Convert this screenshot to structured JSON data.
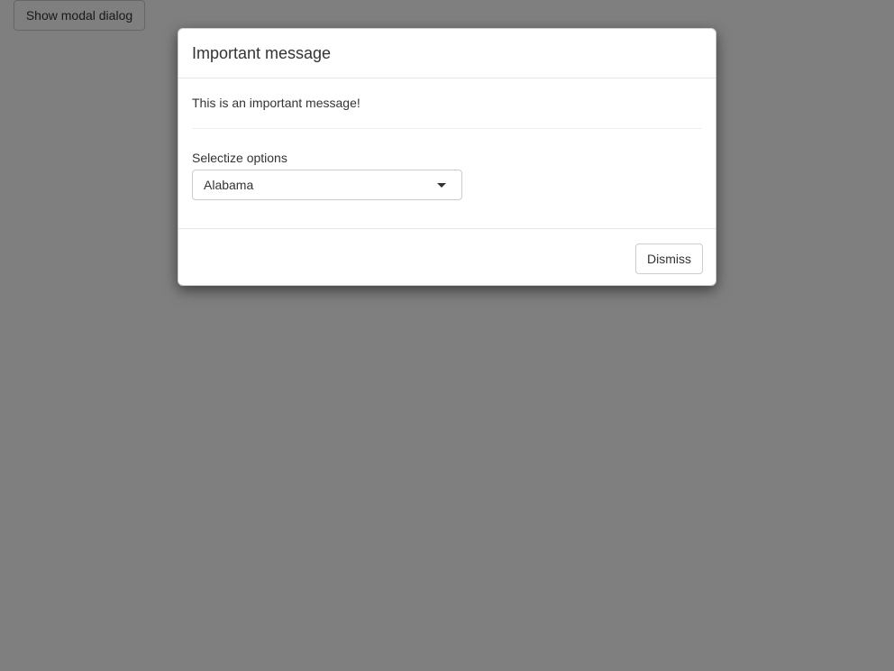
{
  "page": {
    "show_modal_label": "Show modal dialog"
  },
  "modal": {
    "title": "Important message",
    "body_text": "This is an important message!",
    "select": {
      "label": "Selectize options",
      "selected_value": "Alabama"
    },
    "dismiss_label": "Dismiss"
  },
  "colors": {
    "backdrop": "#808080",
    "modal_background": "#ffffff",
    "text": "#333333",
    "border": "#cccccc"
  },
  "icons": {
    "select_toggle": "caret-down-icon"
  }
}
